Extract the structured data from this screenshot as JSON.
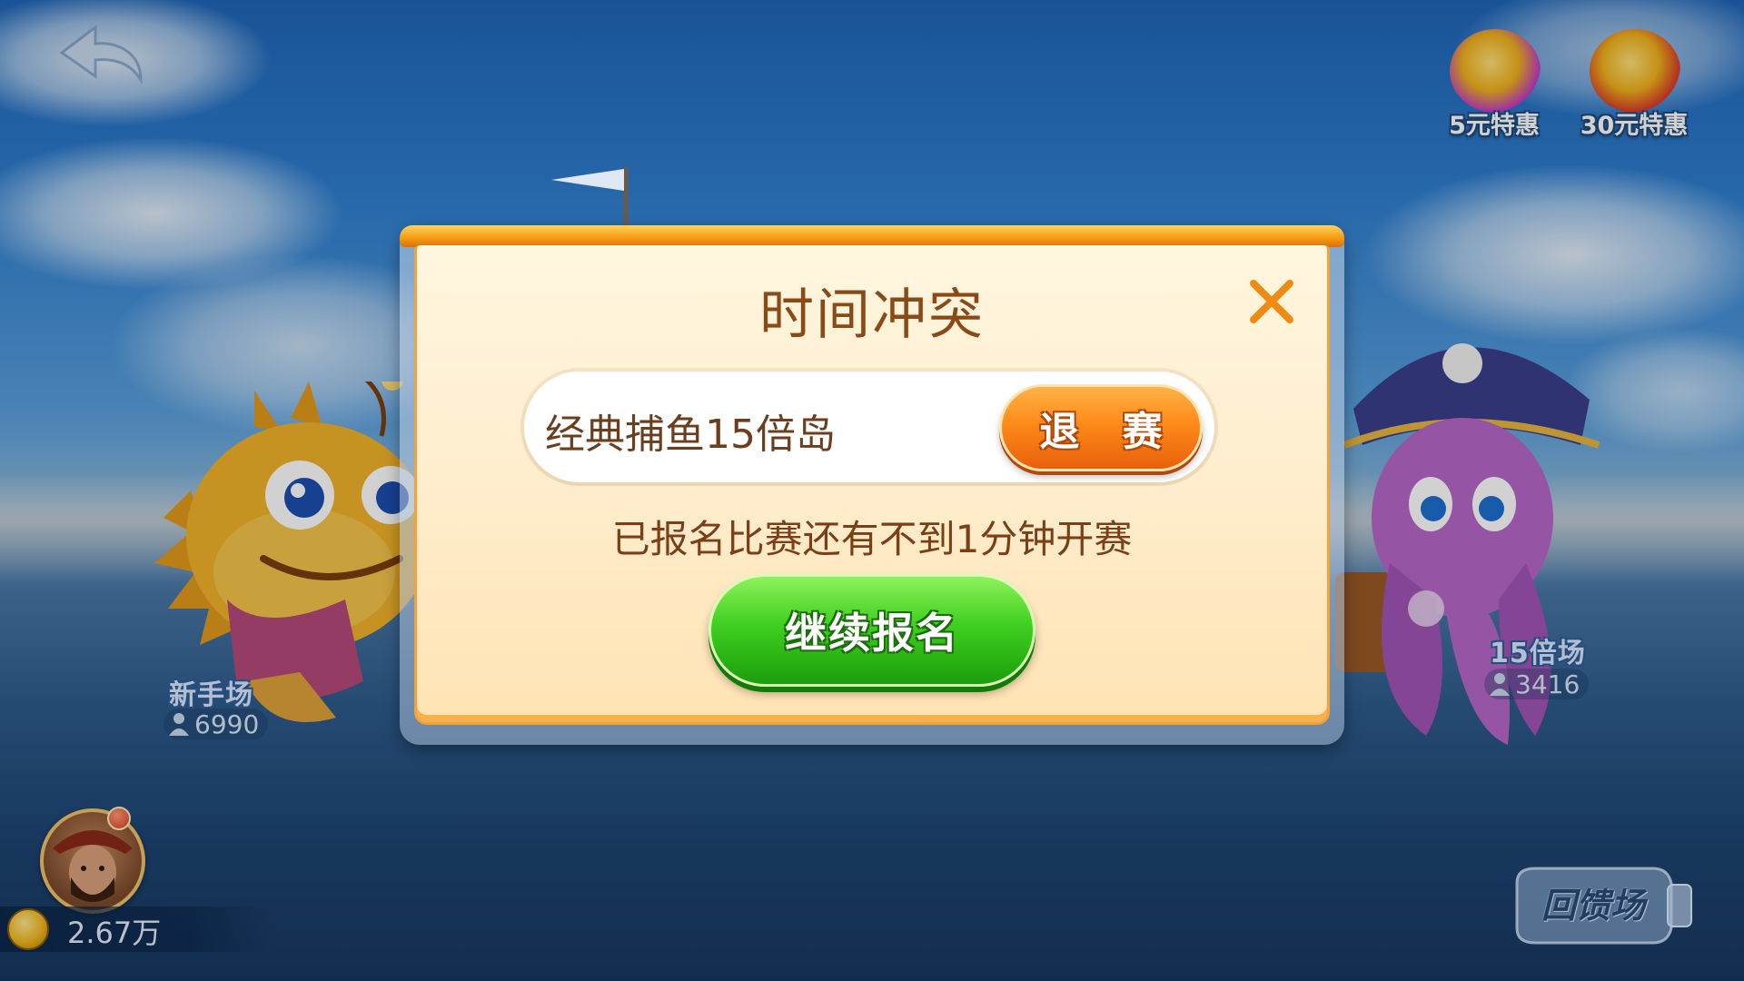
{
  "top_right_deals": [
    {
      "label": "5元特惠",
      "icon": "coin-gift-box-icon",
      "accent": "#c03acb"
    },
    {
      "label": "30元特惠",
      "icon": "coin-red-envelope-icon",
      "accent": "#d83a2a"
    }
  ],
  "rooms": {
    "left": {
      "name": "新手场",
      "players": "6990",
      "mascot": "pufferfish-mascot"
    },
    "right": {
      "name": "15倍场",
      "players": "3416",
      "mascot": "octopus-pirate-mascot"
    }
  },
  "player": {
    "coins": "2.67万"
  },
  "feedback_room": {
    "label": "回馈场"
  },
  "dialog": {
    "title": "时间冲突",
    "event_name": "经典捕鱼15倍岛",
    "withdraw_label": "退 赛",
    "notice": "已报名比赛还有不到1分钟开赛",
    "continue_label": "继续报名"
  },
  "colors": {
    "dialog_orange": "#f59a12",
    "withdraw_orange": "#ff8a1a",
    "continue_green": "#3fcf20",
    "title_brown": "#8a4a18"
  }
}
